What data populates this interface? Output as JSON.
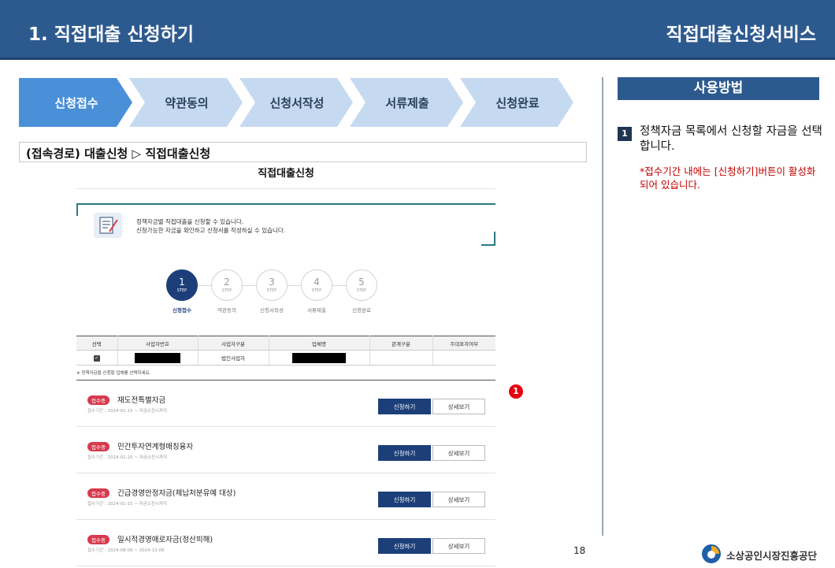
{
  "header": {
    "title": "1. 직접대출 신청하기",
    "service": "직접대출신청서비스"
  },
  "process_steps": [
    {
      "label": "신청접수",
      "active": true
    },
    {
      "label": "약관동의",
      "active": false
    },
    {
      "label": "신청서작성",
      "active": false
    },
    {
      "label": "서류제출",
      "active": false
    },
    {
      "label": "신청완료",
      "active": false
    }
  ],
  "access_path": "(접속경로) 대출신청 ▷ 직접대출신청",
  "screen": {
    "title": "직접대출신청",
    "info_line1": "정책자금별 직접대출을 신청할 수 있습니다.",
    "info_line2": "신청가능한 자금을 확인하고 신청서를 작성하실 수 있습니다.",
    "steps": [
      {
        "num": "1",
        "step": "STEP",
        "label": "신청접수",
        "active": true
      },
      {
        "num": "2",
        "step": "STEP",
        "label": "약관동의",
        "active": false
      },
      {
        "num": "3",
        "step": "STEP",
        "label": "신청서작성",
        "active": false
      },
      {
        "num": "4",
        "step": "STEP",
        "label": "서류제출",
        "active": false
      },
      {
        "num": "5",
        "step": "STEP",
        "label": "신청완료",
        "active": false
      }
    ],
    "table": {
      "headers": [
        "선택",
        "사업자번호",
        "사업자구분",
        "업체명",
        "관계구분",
        "주대표자여부"
      ],
      "row": {
        "check": "✓",
        "biz_number": "",
        "biz_type": "법인사업자",
        "company": "",
        "relation": "",
        "main_rep": ""
      }
    },
    "note": "※ 정책자금을 신청할 업체를 선택하세요.",
    "funds": [
      {
        "badge": "접수중",
        "name": "재도전특별자금",
        "period": "접수기간 : 2024-01-15 ~ 자금소진시까지",
        "apply": "신청하기",
        "detail": "상세보기"
      },
      {
        "badge": "접수중",
        "name": "민간투자연계형매칭융자",
        "period": "접수기간 : 2024-01-15 ~ 자금소진시까지",
        "apply": "신청하기",
        "detail": "상세보기"
      },
      {
        "badge": "접수중",
        "name": "긴급경영안정자금(체납처분유예 대상)",
        "period": "접수기간 : 2024-01-15 ~ 자금소진시까지",
        "apply": "신청하기",
        "detail": "상세보기"
      },
      {
        "badge": "접수중",
        "name": "일시적경영애로자금(정산피해)",
        "period": "접수기간 : 2024-08-09 ~ 2024-12-06",
        "apply": "신청하기",
        "detail": "상세보기"
      }
    ]
  },
  "marker": "1",
  "usage": {
    "title": "사용방법",
    "num": "1",
    "text": "정책자금 목록에서 신청할 자금을 선택합니다.",
    "note": "*접수기간 내에는 [신청하기]버튼이 활성화 되어 있습니다."
  },
  "page_number": "18",
  "org_name": "소상공인시장진흥공단",
  "colors": {
    "header_bg": "#2d5a8e",
    "step_active": "#4a90d9",
    "step_inactive": "#c5d9f1",
    "apply_button": "#1c3f7a",
    "badge": "#d63a4d",
    "marker": "#e60012",
    "note_text": "#c00000"
  }
}
